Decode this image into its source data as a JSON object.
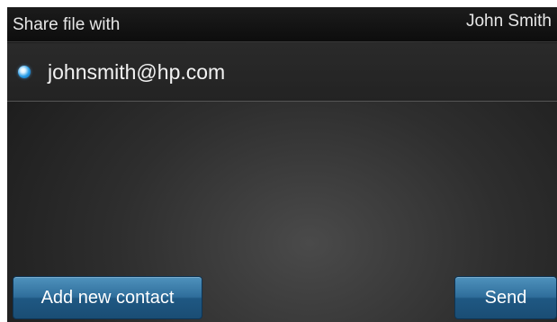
{
  "header": {
    "title": "Share file with",
    "user": "John Smith"
  },
  "contacts": [
    {
      "label": "johnsmith@hp.com",
      "selected": true
    }
  ],
  "actions": {
    "add_contact_label": "Add new contact",
    "send_label": "Send"
  },
  "colors": {
    "button_accent": "#2f6e9b",
    "radio_selected": "#2a9de6"
  }
}
